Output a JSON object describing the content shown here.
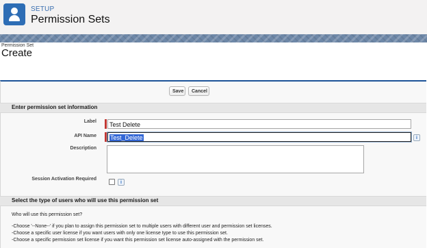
{
  "header": {
    "eyebrow": "SETUP",
    "title": "Permission Sets",
    "icon": "user-icon"
  },
  "page": {
    "eyebrow": "Permission Set",
    "title": "Create"
  },
  "toolbar": {
    "save_label": "Save",
    "cancel_label": "Cancel"
  },
  "section_info": {
    "title": "Enter permission set information"
  },
  "fields": {
    "label": {
      "label": "Label",
      "value": "Test Delete"
    },
    "api_name": {
      "label": "API Name",
      "value": "Test_Delete"
    },
    "description": {
      "label": "Description",
      "value": ""
    },
    "session": {
      "label": "Session Activation Required",
      "checked": false
    }
  },
  "section_users": {
    "title": "Select the type of users who will use this permission set",
    "question": "Who will use this permission set?",
    "lines": [
      "-Choose '--None--' if you plan to assign this permission set to multiple users with different user and permission set licenses.",
      "-Choose a specific user license if you want users with only one license type to use this permission set.",
      "-Choose a specific permission set license if you want this permission set license auto-assigned with the permission set."
    ]
  },
  "icons": {
    "info": "i"
  },
  "colors": {
    "accent": "#1b5297",
    "header_icon": "#2d6db5",
    "required": "#c23934",
    "selection": "#3367d6"
  }
}
